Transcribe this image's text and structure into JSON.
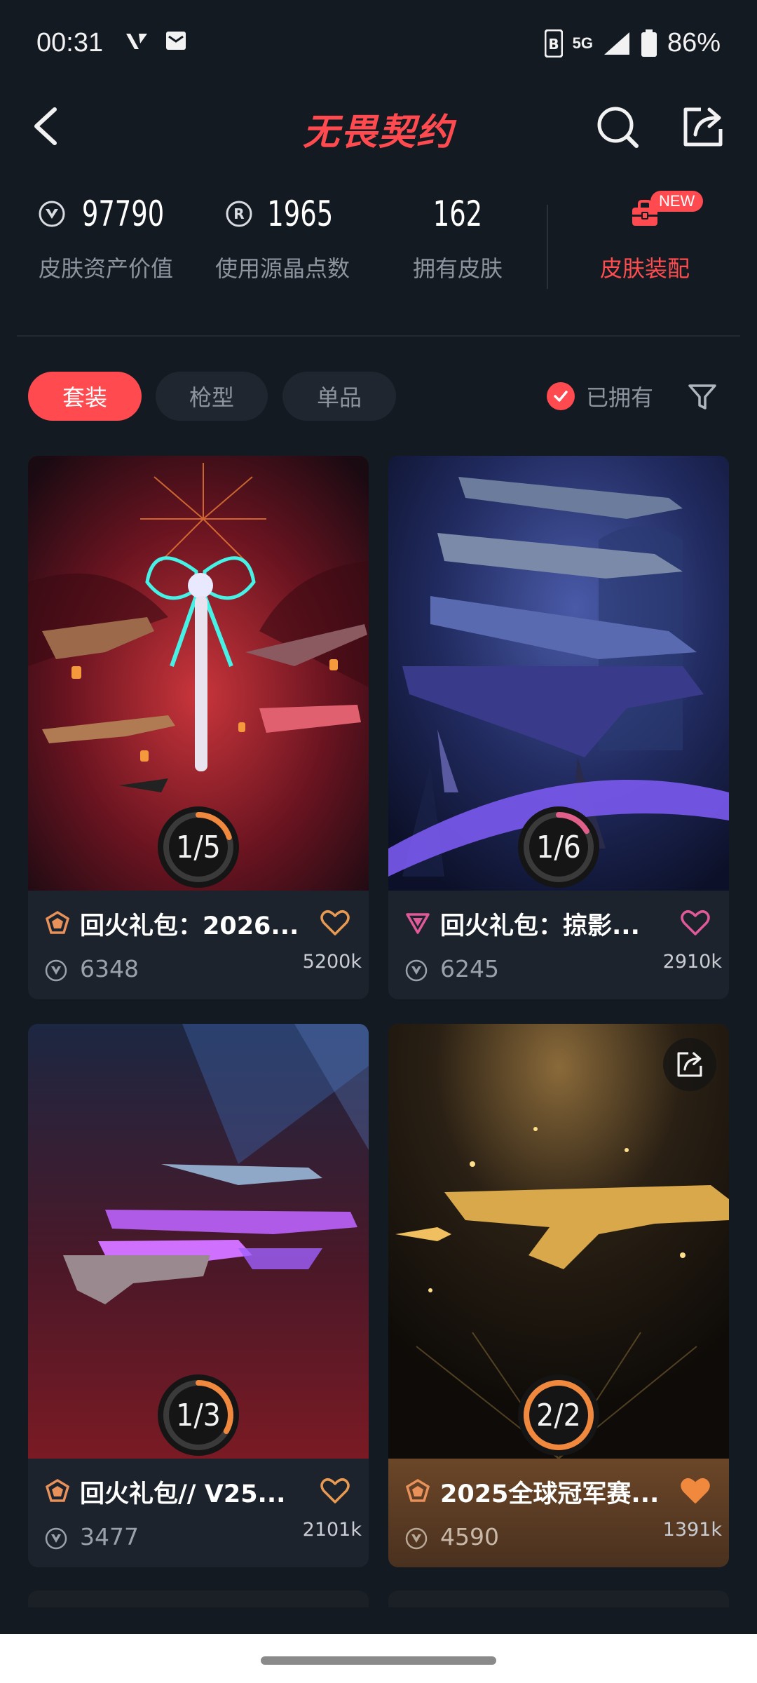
{
  "status_bar": {
    "time": "00:31",
    "network": "5G",
    "battery": "86%"
  },
  "header": {
    "title": "无畏契约"
  },
  "stats": {
    "asset_value": {
      "value": "97790",
      "label": "皮肤资产价值",
      "icon": "vp-icon"
    },
    "radianite": {
      "value": "1965",
      "label": "使用源晶点数",
      "icon": "radianite-icon"
    },
    "owned_skins": {
      "value": "162",
      "label": "拥有皮肤"
    },
    "outfit": {
      "label": "皮肤装配",
      "badge": "NEW",
      "icon": "locker-icon"
    }
  },
  "filters": {
    "tabs": [
      {
        "label": "套装",
        "active": true
      },
      {
        "label": "枪型",
        "active": false
      },
      {
        "label": "单品",
        "active": false
      }
    ],
    "owned_label": "已拥有"
  },
  "cards": [
    {
      "title": "回火礼包：2026...",
      "price": "6348",
      "likes": "5200k",
      "progress": "1/5",
      "progress_fraction": 0.2,
      "liked": false,
      "rarity": "premium"
    },
    {
      "title": "回火礼包：掠影...",
      "price": "6245",
      "likes": "2910k",
      "progress": "1/6",
      "progress_fraction": 0.167,
      "liked": false,
      "rarity": "exclusive"
    },
    {
      "title": "回火礼包// V25...",
      "price": "3477",
      "likes": "2101k",
      "progress": "1/3",
      "progress_fraction": 0.333,
      "liked": false,
      "rarity": "premium"
    },
    {
      "title": "2025全球冠军赛...",
      "price": "4590",
      "likes": "1391k",
      "progress": "2/2",
      "progress_fraction": 1.0,
      "liked": true,
      "rarity": "premium"
    }
  ],
  "colors": {
    "accent": "#ff4a4f",
    "background": "#141a22",
    "progress_orange": "#f0883e"
  }
}
